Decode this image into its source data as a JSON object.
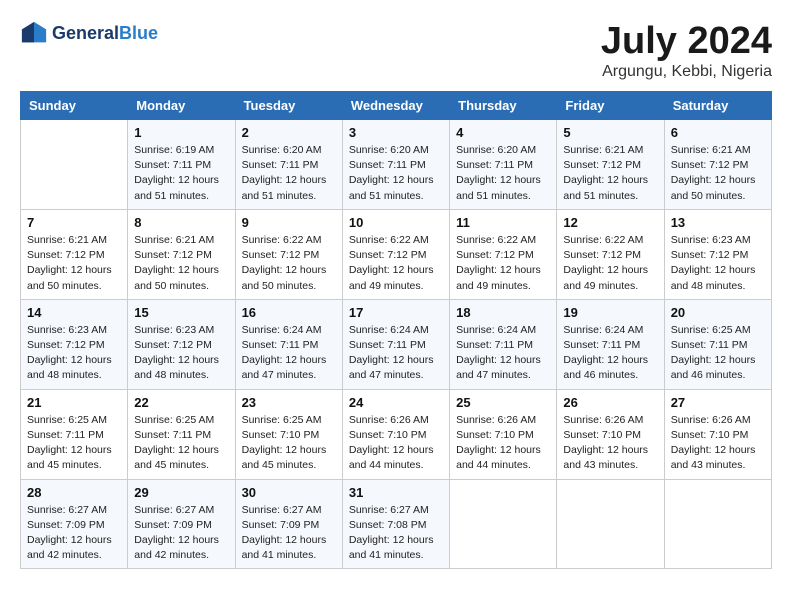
{
  "logo": {
    "line1": "General",
    "line2": "Blue"
  },
  "title": "July 2024",
  "location": "Argungu, Kebbi, Nigeria",
  "header": {
    "days": [
      "Sunday",
      "Monday",
      "Tuesday",
      "Wednesday",
      "Thursday",
      "Friday",
      "Saturday"
    ]
  },
  "weeks": [
    [
      {
        "date": "",
        "sunrise": "",
        "sunset": "",
        "daylight": ""
      },
      {
        "date": "1",
        "sunrise": "Sunrise: 6:19 AM",
        "sunset": "Sunset: 7:11 PM",
        "daylight": "Daylight: 12 hours and 51 minutes."
      },
      {
        "date": "2",
        "sunrise": "Sunrise: 6:20 AM",
        "sunset": "Sunset: 7:11 PM",
        "daylight": "Daylight: 12 hours and 51 minutes."
      },
      {
        "date": "3",
        "sunrise": "Sunrise: 6:20 AM",
        "sunset": "Sunset: 7:11 PM",
        "daylight": "Daylight: 12 hours and 51 minutes."
      },
      {
        "date": "4",
        "sunrise": "Sunrise: 6:20 AM",
        "sunset": "Sunset: 7:11 PM",
        "daylight": "Daylight: 12 hours and 51 minutes."
      },
      {
        "date": "5",
        "sunrise": "Sunrise: 6:21 AM",
        "sunset": "Sunset: 7:12 PM",
        "daylight": "Daylight: 12 hours and 51 minutes."
      },
      {
        "date": "6",
        "sunrise": "Sunrise: 6:21 AM",
        "sunset": "Sunset: 7:12 PM",
        "daylight": "Daylight: 12 hours and 50 minutes."
      }
    ],
    [
      {
        "date": "7",
        "sunrise": "Sunrise: 6:21 AM",
        "sunset": "Sunset: 7:12 PM",
        "daylight": "Daylight: 12 hours and 50 minutes."
      },
      {
        "date": "8",
        "sunrise": "Sunrise: 6:21 AM",
        "sunset": "Sunset: 7:12 PM",
        "daylight": "Daylight: 12 hours and 50 minutes."
      },
      {
        "date": "9",
        "sunrise": "Sunrise: 6:22 AM",
        "sunset": "Sunset: 7:12 PM",
        "daylight": "Daylight: 12 hours and 50 minutes."
      },
      {
        "date": "10",
        "sunrise": "Sunrise: 6:22 AM",
        "sunset": "Sunset: 7:12 PM",
        "daylight": "Daylight: 12 hours and 49 minutes."
      },
      {
        "date": "11",
        "sunrise": "Sunrise: 6:22 AM",
        "sunset": "Sunset: 7:12 PM",
        "daylight": "Daylight: 12 hours and 49 minutes."
      },
      {
        "date": "12",
        "sunrise": "Sunrise: 6:22 AM",
        "sunset": "Sunset: 7:12 PM",
        "daylight": "Daylight: 12 hours and 49 minutes."
      },
      {
        "date": "13",
        "sunrise": "Sunrise: 6:23 AM",
        "sunset": "Sunset: 7:12 PM",
        "daylight": "Daylight: 12 hours and 48 minutes."
      }
    ],
    [
      {
        "date": "14",
        "sunrise": "Sunrise: 6:23 AM",
        "sunset": "Sunset: 7:12 PM",
        "daylight": "Daylight: 12 hours and 48 minutes."
      },
      {
        "date": "15",
        "sunrise": "Sunrise: 6:23 AM",
        "sunset": "Sunset: 7:12 PM",
        "daylight": "Daylight: 12 hours and 48 minutes."
      },
      {
        "date": "16",
        "sunrise": "Sunrise: 6:24 AM",
        "sunset": "Sunset: 7:11 PM",
        "daylight": "Daylight: 12 hours and 47 minutes."
      },
      {
        "date": "17",
        "sunrise": "Sunrise: 6:24 AM",
        "sunset": "Sunset: 7:11 PM",
        "daylight": "Daylight: 12 hours and 47 minutes."
      },
      {
        "date": "18",
        "sunrise": "Sunrise: 6:24 AM",
        "sunset": "Sunset: 7:11 PM",
        "daylight": "Daylight: 12 hours and 47 minutes."
      },
      {
        "date": "19",
        "sunrise": "Sunrise: 6:24 AM",
        "sunset": "Sunset: 7:11 PM",
        "daylight": "Daylight: 12 hours and 46 minutes."
      },
      {
        "date": "20",
        "sunrise": "Sunrise: 6:25 AM",
        "sunset": "Sunset: 7:11 PM",
        "daylight": "Daylight: 12 hours and 46 minutes."
      }
    ],
    [
      {
        "date": "21",
        "sunrise": "Sunrise: 6:25 AM",
        "sunset": "Sunset: 7:11 PM",
        "daylight": "Daylight: 12 hours and 45 minutes."
      },
      {
        "date": "22",
        "sunrise": "Sunrise: 6:25 AM",
        "sunset": "Sunset: 7:11 PM",
        "daylight": "Daylight: 12 hours and 45 minutes."
      },
      {
        "date": "23",
        "sunrise": "Sunrise: 6:25 AM",
        "sunset": "Sunset: 7:10 PM",
        "daylight": "Daylight: 12 hours and 45 minutes."
      },
      {
        "date": "24",
        "sunrise": "Sunrise: 6:26 AM",
        "sunset": "Sunset: 7:10 PM",
        "daylight": "Daylight: 12 hours and 44 minutes."
      },
      {
        "date": "25",
        "sunrise": "Sunrise: 6:26 AM",
        "sunset": "Sunset: 7:10 PM",
        "daylight": "Daylight: 12 hours and 44 minutes."
      },
      {
        "date": "26",
        "sunrise": "Sunrise: 6:26 AM",
        "sunset": "Sunset: 7:10 PM",
        "daylight": "Daylight: 12 hours and 43 minutes."
      },
      {
        "date": "27",
        "sunrise": "Sunrise: 6:26 AM",
        "sunset": "Sunset: 7:10 PM",
        "daylight": "Daylight: 12 hours and 43 minutes."
      }
    ],
    [
      {
        "date": "28",
        "sunrise": "Sunrise: 6:27 AM",
        "sunset": "Sunset: 7:09 PM",
        "daylight": "Daylight: 12 hours and 42 minutes."
      },
      {
        "date": "29",
        "sunrise": "Sunrise: 6:27 AM",
        "sunset": "Sunset: 7:09 PM",
        "daylight": "Daylight: 12 hours and 42 minutes."
      },
      {
        "date": "30",
        "sunrise": "Sunrise: 6:27 AM",
        "sunset": "Sunset: 7:09 PM",
        "daylight": "Daylight: 12 hours and 41 minutes."
      },
      {
        "date": "31",
        "sunrise": "Sunrise: 6:27 AM",
        "sunset": "Sunset: 7:08 PM",
        "daylight": "Daylight: 12 hours and 41 minutes."
      },
      {
        "date": "",
        "sunrise": "",
        "sunset": "",
        "daylight": ""
      },
      {
        "date": "",
        "sunrise": "",
        "sunset": "",
        "daylight": ""
      },
      {
        "date": "",
        "sunrise": "",
        "sunset": "",
        "daylight": ""
      }
    ]
  ]
}
